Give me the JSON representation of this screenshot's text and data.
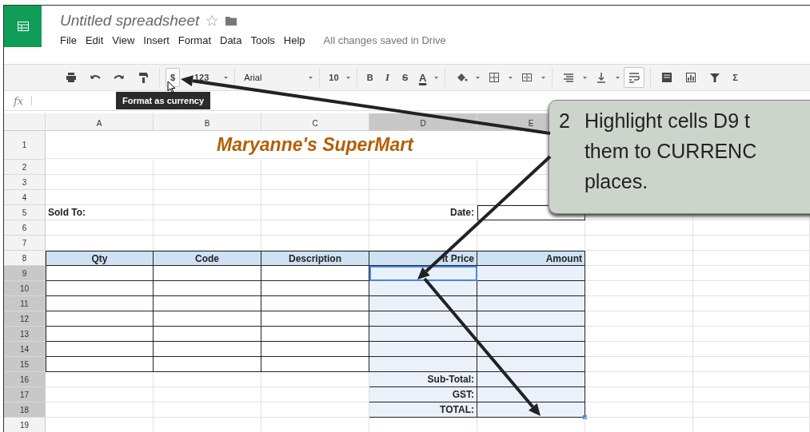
{
  "document": {
    "title": "Untitled spreadsheet",
    "starred": false
  },
  "menu": [
    "File",
    "Edit",
    "View",
    "Insert",
    "Format",
    "Data",
    "Tools",
    "Help"
  ],
  "save_status": "All changes saved in Drive",
  "toolbar": [
    [
      {
        "kind": "print",
        "pressed": false
      },
      {
        "kind": "undo",
        "pressed": false
      },
      {
        "kind": "redo",
        "pressed": false
      },
      {
        "kind": "paint",
        "pressed": false
      }
    ],
    [
      {
        "kind": "text",
        "label": "$",
        "pressed": true
      },
      {
        "kind": "text",
        "label": "123",
        "pressed": false
      },
      {
        "kind": "caret",
        "pressed": false
      }
    ],
    [
      {
        "kind": "wide",
        "label": "Arial",
        "pressed": false
      },
      {
        "kind": "caret",
        "pressed": false
      }
    ],
    [
      {
        "kind": "text",
        "label": "10",
        "pressed": false
      },
      {
        "kind": "caret",
        "pressed": false
      }
    ],
    [
      {
        "kind": "bold",
        "label": "B",
        "pressed": false
      },
      {
        "kind": "italic",
        "label": "I",
        "pressed": false
      },
      {
        "kind": "strike",
        "label": "S",
        "pressed": false
      },
      {
        "kind": "color",
        "label": "A",
        "pressed": false
      },
      {
        "kind": "caret",
        "pressed": false
      }
    ],
    [
      {
        "kind": "fill",
        "pressed": false
      },
      {
        "kind": "caret",
        "pressed": false
      },
      {
        "kind": "borders",
        "pressed": false
      },
      {
        "kind": "caret",
        "pressed": false
      },
      {
        "kind": "merge",
        "pressed": false
      },
      {
        "kind": "caret",
        "pressed": false
      }
    ],
    [
      {
        "kind": "align",
        "pressed": false
      },
      {
        "kind": "caret",
        "pressed": false
      },
      {
        "kind": "valign",
        "pressed": false
      },
      {
        "kind": "caret",
        "pressed": false
      },
      {
        "kind": "wrap",
        "pressed": true
      }
    ],
    [
      {
        "kind": "comment",
        "pressed": false
      },
      {
        "kind": "chart",
        "pressed": false
      },
      {
        "kind": "filter",
        "pressed": false
      },
      {
        "kind": "text",
        "label": "Σ",
        "pressed": false
      }
    ]
  ],
  "tooltip": "Format as currency",
  "formula_bar": {
    "label": "fx"
  },
  "columns": [
    {
      "label": "A",
      "selected": false
    },
    {
      "label": "B",
      "selected": false
    },
    {
      "label": "C",
      "selected": false
    },
    {
      "label": "D",
      "selected": true
    },
    {
      "label": "E",
      "selected": true
    },
    {},
    {}
  ],
  "rows": [
    {
      "number": "1",
      "kind": "title",
      "title": "Maryanne's SuperMart",
      "selected": false,
      "active": false
    },
    {
      "number": "2",
      "kind": "blank",
      "selected": false,
      "active": false
    },
    {
      "number": "3",
      "kind": "blank",
      "selected": false,
      "active": false
    },
    {
      "number": "4",
      "kind": "blank",
      "selected": false,
      "active": false
    },
    {
      "number": "5",
      "kind": "label",
      "a": "Sold To:",
      "d": "Date:",
      "selected": false,
      "active": false
    },
    {
      "number": "6",
      "kind": "blank",
      "selected": false,
      "active": false
    },
    {
      "number": "7",
      "kind": "blank",
      "selected": false,
      "active": false
    },
    {
      "number": "8",
      "kind": "header",
      "a": "Qty",
      "b": "Code",
      "c": "Description",
      "d": "it Price",
      "e": "Amount",
      "selected": false,
      "active": false
    },
    {
      "number": "9",
      "kind": "item",
      "selected": true,
      "active": true
    },
    {
      "number": "10",
      "kind": "item",
      "selected": true,
      "active": false
    },
    {
      "number": "11",
      "kind": "item",
      "selected": true,
      "active": false
    },
    {
      "number": "12",
      "kind": "item",
      "selected": true,
      "active": false
    },
    {
      "number": "13",
      "kind": "item",
      "selected": true,
      "active": false
    },
    {
      "number": "14",
      "kind": "item",
      "selected": true,
      "active": false
    },
    {
      "number": "15",
      "kind": "item",
      "selected": true,
      "active": false
    },
    {
      "number": "16",
      "kind": "total",
      "d": "Sub-Total:",
      "selected": true,
      "active": false
    },
    {
      "number": "17",
      "kind": "total",
      "d": "GST:",
      "selected": true,
      "active": false
    },
    {
      "number": "18",
      "kind": "total",
      "d": "TOTAL:",
      "selected": true,
      "active": false
    },
    {
      "number": "19",
      "kind": "blank",
      "selected": false,
      "active": false
    }
  ],
  "callout": {
    "step": "2",
    "lines": [
      "Highlight cells D9 t",
      "them to CURRENC",
      "places."
    ]
  }
}
